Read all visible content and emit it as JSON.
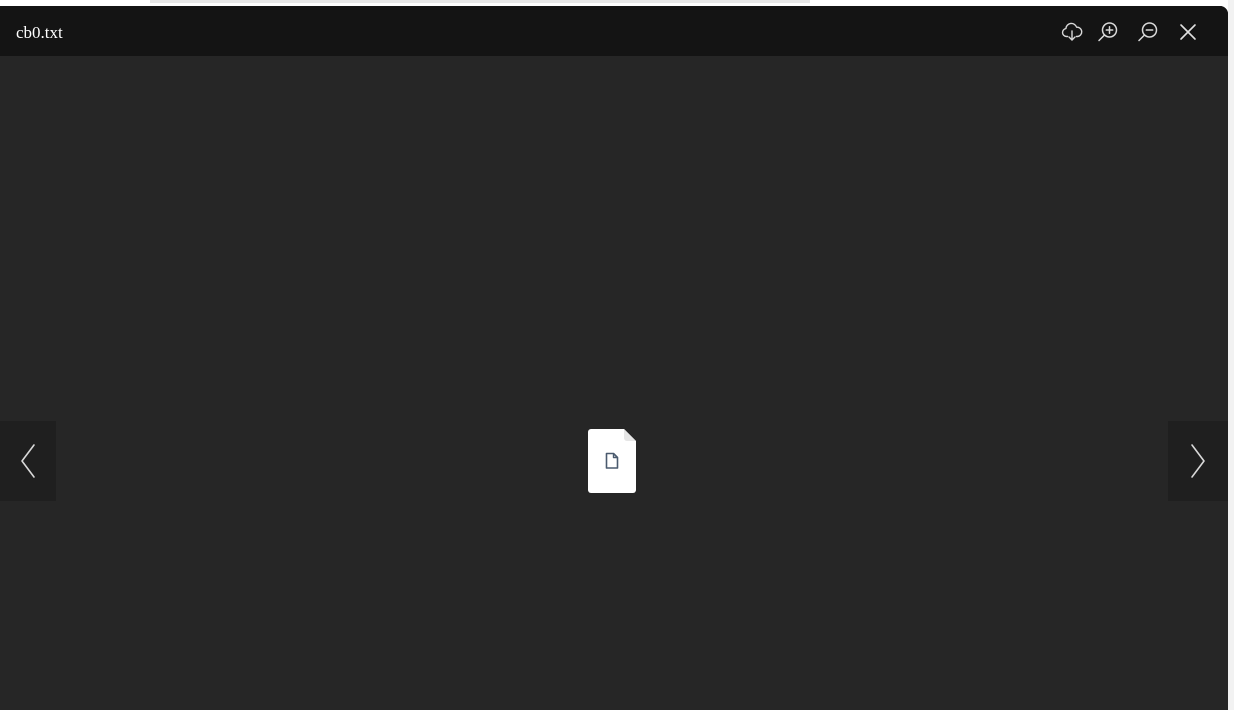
{
  "viewer": {
    "file_name": "cb0.txt"
  },
  "toolbar": {
    "download_icon": "cloud-download-icon",
    "zoom_in_icon": "zoom-in-icon",
    "zoom_out_icon": "zoom-out-icon",
    "close_icon": "close-icon"
  },
  "navigation": {
    "prev_icon": "chevron-left-icon",
    "next_icon": "chevron-right-icon"
  },
  "preview": {
    "icon": "file-document-icon"
  },
  "colors": {
    "header_bg": "#141414",
    "stage_bg": "#262626",
    "nav_bg": "#1f1f1f",
    "icon_color": "#d9d9d9",
    "file_glyph": "#4a5a6e"
  }
}
